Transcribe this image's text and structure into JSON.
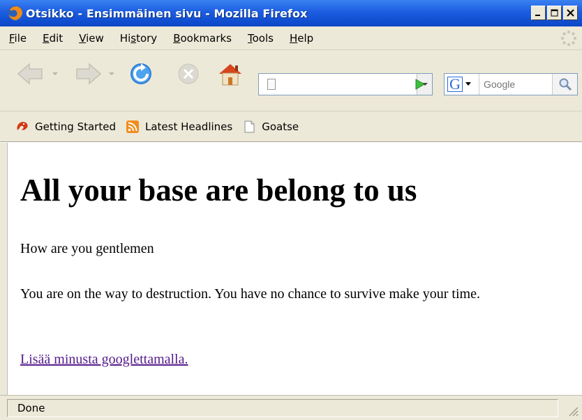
{
  "window": {
    "title": "Otsikko - Ensimmäinen sivu - Mozilla Firefox"
  },
  "menu": {
    "items": [
      {
        "label_prefix": "",
        "underline": "F",
        "label_rest": "ile"
      },
      {
        "label_prefix": "",
        "underline": "E",
        "label_rest": "dit"
      },
      {
        "label_prefix": "",
        "underline": "V",
        "label_rest": "iew"
      },
      {
        "label_prefix": "Hi",
        "underline": "s",
        "label_rest": "tory"
      },
      {
        "label_prefix": "",
        "underline": "B",
        "label_rest": "ookmarks"
      },
      {
        "label_prefix": "",
        "underline": "T",
        "label_rest": "ools"
      },
      {
        "label_prefix": "",
        "underline": "H",
        "label_rest": "elp"
      }
    ]
  },
  "toolbar": {
    "url_value": "",
    "search_placeholder": "Google",
    "icons": [
      "back-arrow-icon",
      "forward-arrow-icon",
      "reload-icon",
      "stop-icon",
      "home-icon",
      "go-arrow-icon",
      "google-icon",
      "magnifier-icon"
    ]
  },
  "bookmarks": {
    "items": [
      {
        "label": "Getting Started",
        "icon": "firefox-icon"
      },
      {
        "label": "Latest Headlines",
        "icon": "rss-icon"
      },
      {
        "label": "Goatse",
        "icon": "page-icon"
      }
    ]
  },
  "page": {
    "heading": "All your base are belong to us",
    "paragraph1": "How are you gentlemen",
    "paragraph2": "You are on the way to destruction. You have no chance to survive make your time.",
    "link": "Lisää minusta googlettamalla."
  },
  "status": {
    "text": "Done"
  },
  "colors": {
    "titlebar": "#1c5de0",
    "chrome": "#ece9d8",
    "link_visited": "#551a8b"
  }
}
